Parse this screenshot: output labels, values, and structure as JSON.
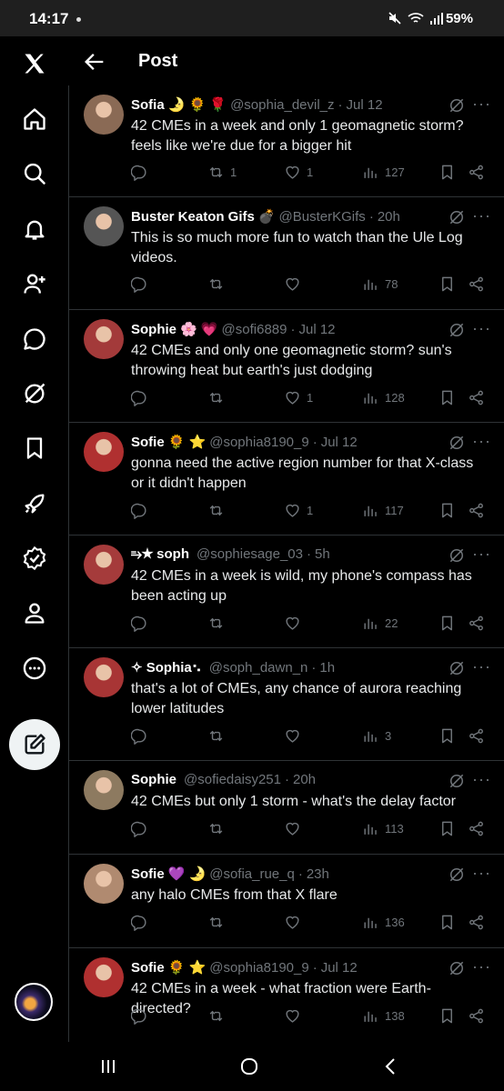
{
  "status": {
    "time": "14:17",
    "battery": "59%"
  },
  "header": {
    "title": "Post"
  },
  "posts": [
    {
      "name": "Sofia",
      "emoji": "🌛 🌻 🌹",
      "handle": "@sophia_devil_z",
      "time": "Jul 12",
      "text": "42 CMEs in a week and only 1 geomagnetic storm? feels like we're due for a bigger hit",
      "replies": "",
      "reposts": "1",
      "likes": "1",
      "views": "127",
      "avatar_color": "#8a6a55"
    },
    {
      "name": "Buster Keaton Gifs",
      "emoji": "💣",
      "handle": "@BusterKGifs",
      "time": "20h",
      "text": "This is so much more fun to watch than the Ule Log videos.",
      "replies": "",
      "reposts": "",
      "likes": "",
      "views": "78",
      "avatar_color": "#555555"
    },
    {
      "name": "Sophie",
      "emoji": "🌸 💗",
      "handle": "@sofi6889",
      "time": "Jul 12",
      "text": "42 CMEs and only one geomagnetic storm? sun's throwing heat but earth's just dodging",
      "replies": "",
      "reposts": "",
      "likes": "1",
      "views": "128",
      "avatar_color": "#a33a3a"
    },
    {
      "name": "Sofie",
      "emoji": "🌻 ⭐",
      "handle": "@sophia8190_9",
      "time": "Jul 12",
      "text": "gonna need the active region number for that X-class or it didn't happen",
      "replies": "",
      "reposts": "",
      "likes": "1",
      "views": "117",
      "avatar_color": "#b03030"
    },
    {
      "name": "⥱★ soph",
      "emoji": "",
      "handle": "@sophiesage_03",
      "time": "5h",
      "text": "42 CMEs in a week is wild, my phone's compass has been acting up",
      "replies": "",
      "reposts": "",
      "likes": "",
      "views": "22",
      "avatar_color": "#a53b3b"
    },
    {
      "name": "✧ Sophia⠢",
      "emoji": "",
      "handle": "@soph_dawn_n",
      "time": "1h",
      "text": "that's a lot of CMEs, any chance of aurora reaching lower latitudes",
      "replies": "",
      "reposts": "",
      "likes": "",
      "views": "3",
      "avatar_color": "#a83535"
    },
    {
      "name": "Sophie",
      "emoji": "",
      "handle": "@sofiedaisy251",
      "time": "20h",
      "text": "42 CMEs but only 1 storm - what's the delay factor",
      "replies": "",
      "reposts": "",
      "likes": "",
      "views": "113",
      "avatar_color": "#8d7a60"
    },
    {
      "name": "Sofie",
      "emoji": "💜 🌛",
      "handle": "@sofia_rue_q",
      "time": "23h",
      "text": "any halo CMEs from that X flare",
      "replies": "",
      "reposts": "",
      "likes": "",
      "views": "136",
      "avatar_color": "#b08a70"
    },
    {
      "name": "Sofie",
      "emoji": "🌻 ⭐",
      "handle": "@sophia8190_9",
      "time": "Jul 12",
      "text": "42 CMEs in a week - what fraction were Earth-directed?",
      "replies": "",
      "reposts": "",
      "likes": "",
      "views": "138",
      "avatar_color": "#b03030"
    }
  ],
  "rail": [
    "x-logo-icon",
    "home-icon",
    "search-icon",
    "notifications-icon",
    "follow-icon",
    "messages-icon",
    "grok-icon",
    "bookmarks-icon",
    "rocket-icon",
    "verified-icon",
    "profile-icon",
    "more-icon"
  ],
  "colors": {
    "bg": "#000000",
    "text": "#e7e9ea",
    "muted": "#71767b",
    "border": "#2f3336"
  }
}
